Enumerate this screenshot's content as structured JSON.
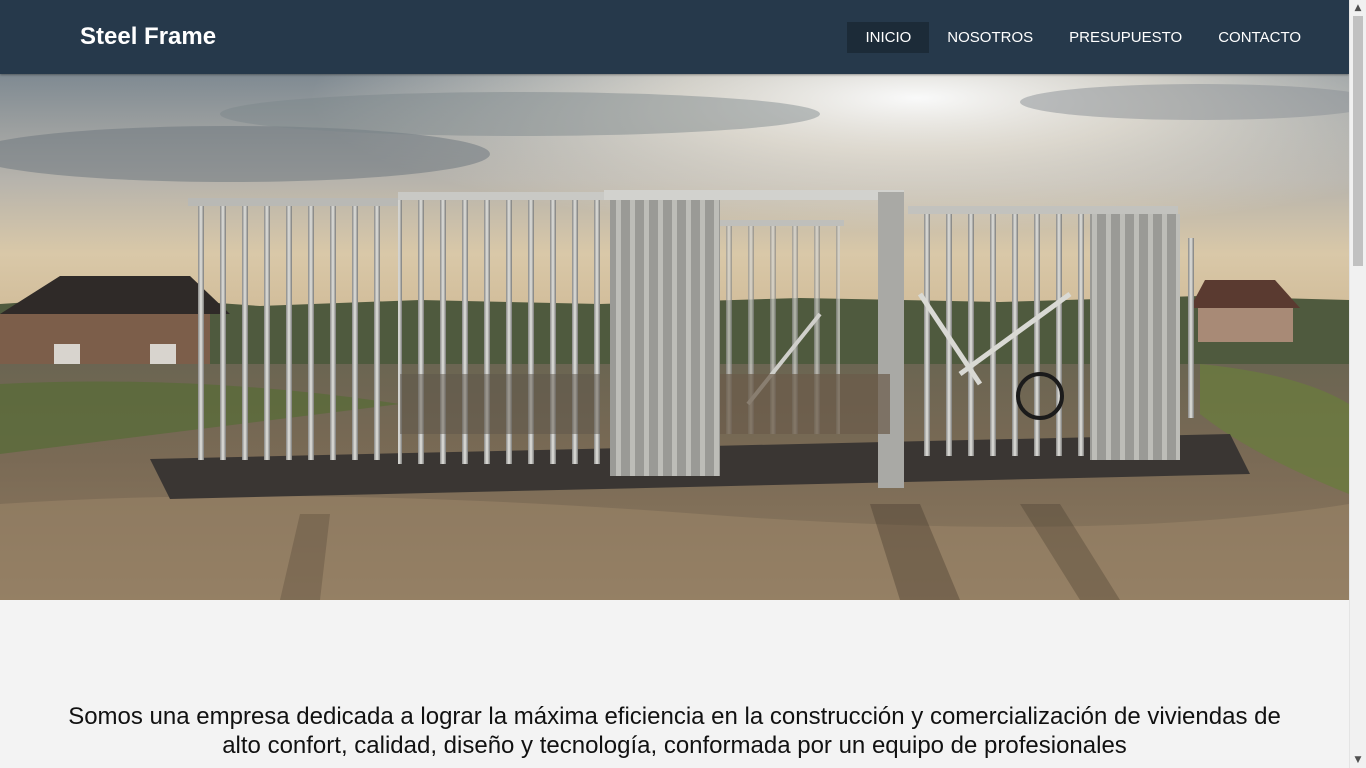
{
  "header": {
    "brand": "Steel Frame",
    "nav": [
      {
        "label": "INICIO",
        "active": true
      },
      {
        "label": "NOSOTROS",
        "active": false
      },
      {
        "label": "PRESUPUESTO",
        "active": false
      },
      {
        "label": "CONTACTO",
        "active": false
      }
    ]
  },
  "hero": {
    "image": "steel-frame-house-construction-photo"
  },
  "intro": {
    "text": "Somos una empresa dedicada a lograr la máxima eficiencia en la construcción y comercialización de viviendas de alto confort, calidad, diseño y tecnología, conformada por un equipo de profesionales"
  },
  "scrollbar": {
    "up_icon": "▲",
    "down_icon": "▼"
  },
  "colors": {
    "navbar": "#26394b",
    "nav_active": "#1c2b38",
    "page_bg": "#f3f3f3"
  }
}
